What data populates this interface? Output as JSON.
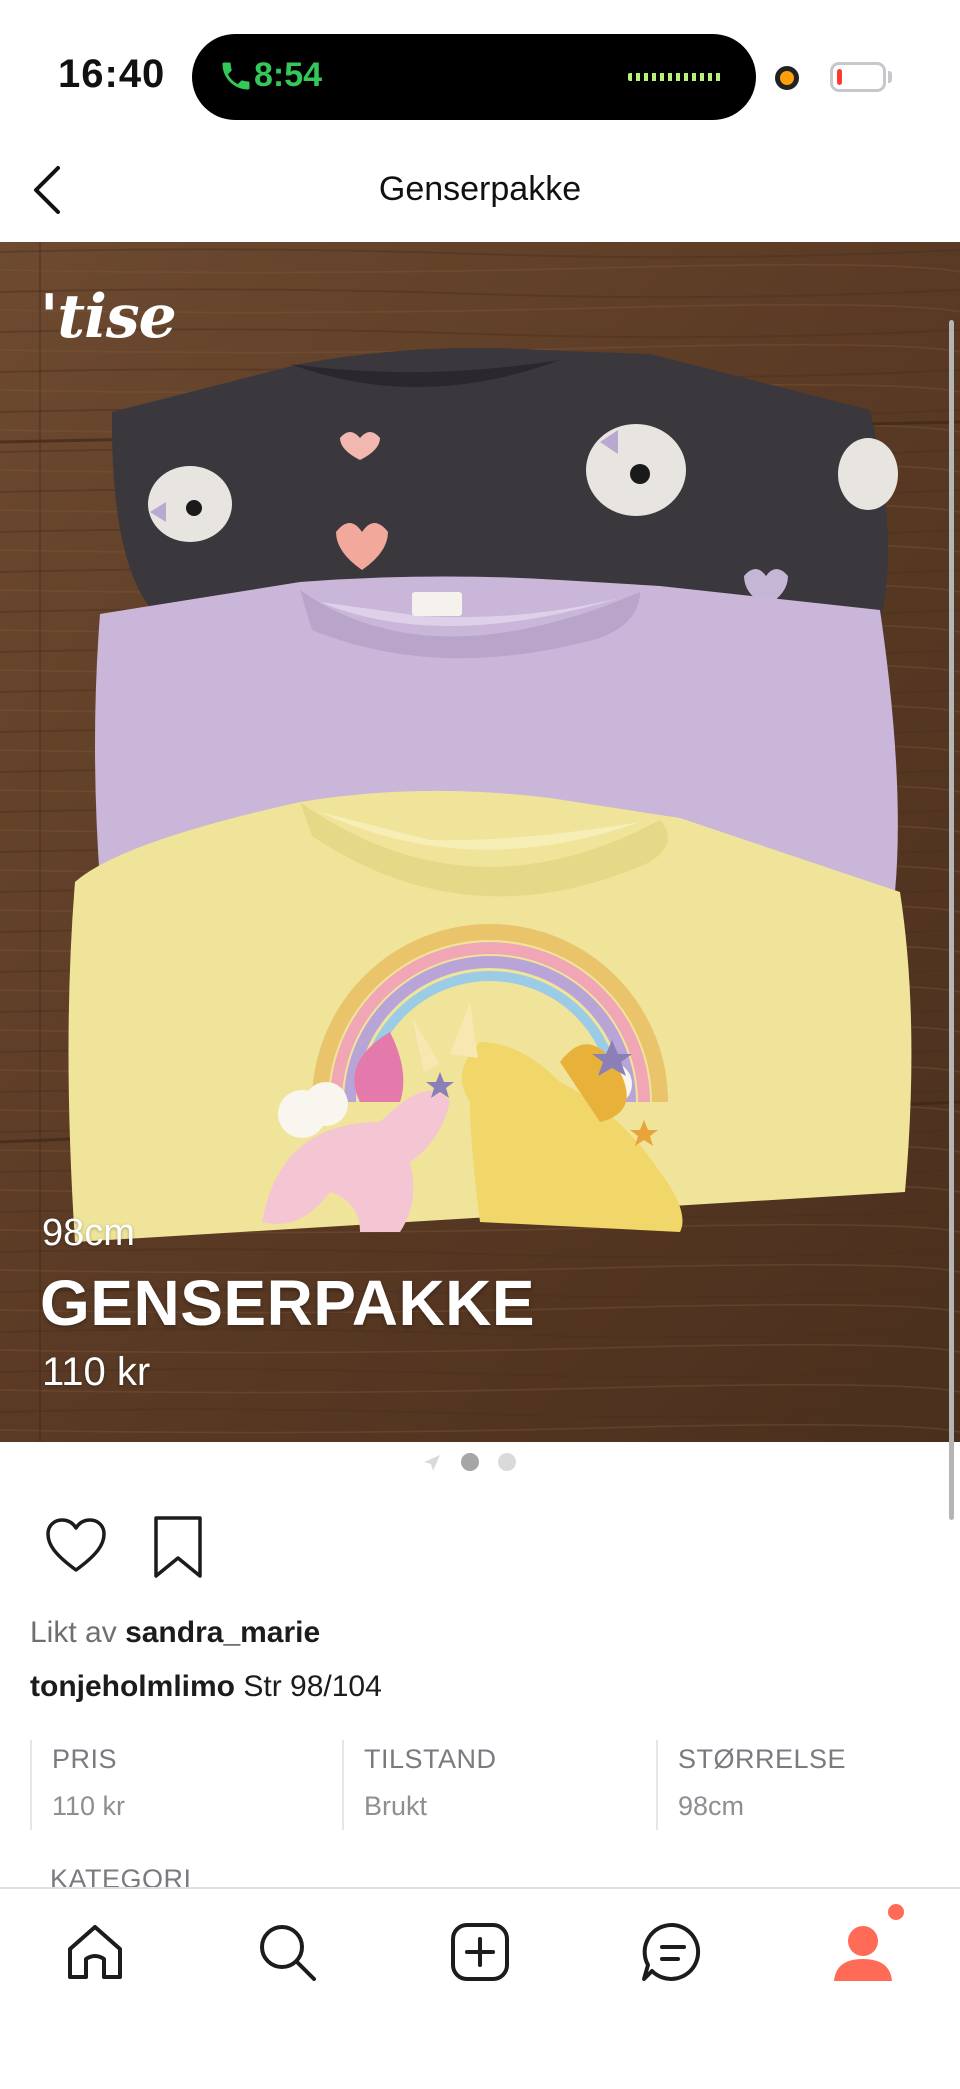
{
  "status_bar": {
    "time": "16:40",
    "call_time": "8:54",
    "call_icon": "phone-icon",
    "battery_level": 0.12
  },
  "header": {
    "title": "Genserpakke",
    "back_icon": "chevron-left-icon"
  },
  "listing_image": {
    "brand": "'tise",
    "size": "98cm",
    "title": "GENSERPAKKE",
    "price": "110 kr",
    "image_count": 2,
    "active_image": 1
  },
  "actions": {
    "like_icon": "heart-icon",
    "save_icon": "bookmark-icon"
  },
  "liked_by": {
    "prefix": "Likt av",
    "user": "sandra_marie"
  },
  "caption": {
    "user": "tonjeholmlimo",
    "text": "Str 98/104"
  },
  "info": [
    {
      "label": "PRIS",
      "value": "110 kr"
    },
    {
      "label": "TILSTAND",
      "value": "Brukt"
    },
    {
      "label": "STØRRELSE",
      "value": "98cm"
    }
  ],
  "kategori_label": "KATEGORI",
  "tabbar": {
    "items": [
      {
        "icon": "home-icon"
      },
      {
        "icon": "search-icon"
      },
      {
        "icon": "add-icon"
      },
      {
        "icon": "chat-icon"
      },
      {
        "icon": "profile-icon"
      }
    ],
    "accent": "#ff6b57"
  },
  "colors": {
    "wood": "#5e3c24",
    "sweater_dark": "#3a373d",
    "sweater_lilac": "#c9b6d8",
    "sweater_yellow": "#efe49a"
  }
}
